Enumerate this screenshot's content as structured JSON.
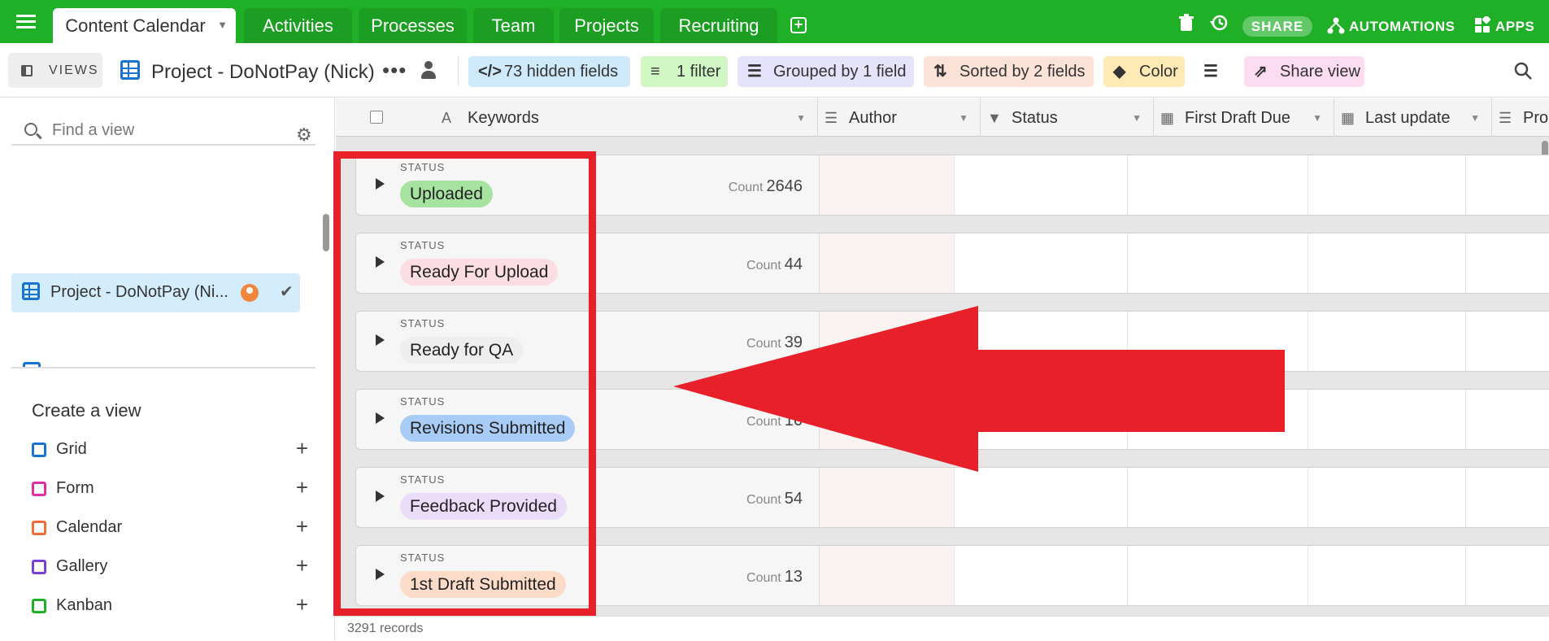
{
  "tabs": [
    {
      "label": "Content Calendar",
      "active": true
    },
    {
      "label": "Activities",
      "active": false
    },
    {
      "label": "Processes",
      "active": false
    },
    {
      "label": "Team",
      "active": false
    },
    {
      "label": "Projects",
      "active": false
    },
    {
      "label": "Recruiting",
      "active": false
    }
  ],
  "topbar": {
    "share": "SHARE",
    "automations": "AUTOMATIONS",
    "apps": "APPS"
  },
  "toolbar": {
    "views_label": "VIEWS",
    "view_name": "Project - DoNotPay (Nick)",
    "hidden_fields": "73 hidden fields",
    "filter": "1 filter",
    "grouped": "Grouped by 1 field",
    "sorted": "Sorted by 2 fields",
    "color": "Color",
    "share_view": "Share view"
  },
  "sidebar": {
    "find_placeholder": "Find a view",
    "active_view": "Project - DoNotPay (Ni...",
    "create_title": "Create a view",
    "create_items": [
      {
        "label": "Grid",
        "color": "#1874d0"
      },
      {
        "label": "Form",
        "color": "#e02fa5"
      },
      {
        "label": "Calendar",
        "color": "#f06a3a"
      },
      {
        "label": "Gallery",
        "color": "#7b3fd9"
      },
      {
        "label": "Kanban",
        "color": "#20b028"
      }
    ]
  },
  "columns": [
    "Keywords",
    "Author",
    "Status",
    "First Draft Due",
    "Last update",
    "Pro"
  ],
  "groups": [
    {
      "field": "STATUS",
      "value": "Uploaded",
      "count_label": "Count",
      "count": "2646",
      "color": "#a6e3a0"
    },
    {
      "field": "STATUS",
      "value": "Ready For Upload",
      "count_label": "Count",
      "count": "44",
      "color": "#fcdde3"
    },
    {
      "field": "STATUS",
      "value": "Ready for QA",
      "count_label": "Count",
      "count": "39",
      "color": "#eeeeee"
    },
    {
      "field": "STATUS",
      "value": "Revisions Submitted",
      "count_label": "Count",
      "count": "16",
      "color": "#a8ccf5"
    },
    {
      "field": "STATUS",
      "value": "Feedback Provided",
      "count_label": "Count",
      "count": "54",
      "color": "#ebdcf9"
    },
    {
      "field": "STATUS",
      "value": "1st Draft Submitted",
      "count_label": "Count",
      "count": "13",
      "color": "#fddbc9"
    }
  ],
  "footer": {
    "records": "3291 records"
  },
  "annotation_color": "#e8202a"
}
